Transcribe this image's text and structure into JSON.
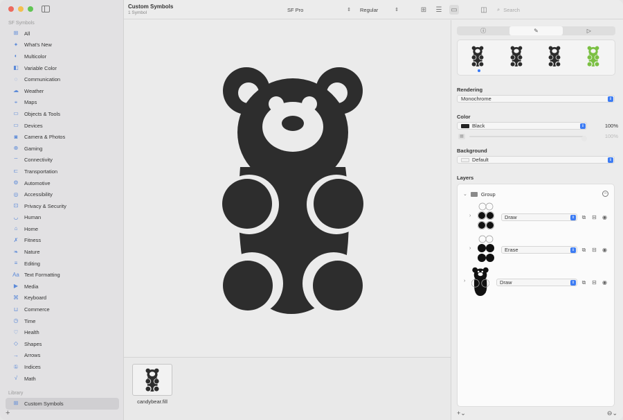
{
  "window": {
    "title": "Custom Symbols",
    "subtitle": "1 Symbol"
  },
  "toolbar": {
    "font": "SF Pro",
    "weight": "Regular",
    "search_placeholder": "Search"
  },
  "sidebar": {
    "section_title": "SF Symbols",
    "items": [
      {
        "label": "All",
        "icon": "grid-icon"
      },
      {
        "label": "What's New",
        "icon": "sparkle-icon"
      },
      {
        "label": "Multicolor",
        "icon": "palette-icon"
      },
      {
        "label": "Variable Color",
        "icon": "variable-icon"
      },
      {
        "label": "Communication",
        "icon": "bubble-icon"
      },
      {
        "label": "Weather",
        "icon": "cloud-icon"
      },
      {
        "label": "Maps",
        "icon": "map-icon"
      },
      {
        "label": "Objects & Tools",
        "icon": "folder-icon"
      },
      {
        "label": "Devices",
        "icon": "display-icon"
      },
      {
        "label": "Camera & Photos",
        "icon": "camera-icon"
      },
      {
        "label": "Gaming",
        "icon": "gamecontroller-icon"
      },
      {
        "label": "Connectivity",
        "icon": "antenna-icon"
      },
      {
        "label": "Transportation",
        "icon": "car-icon"
      },
      {
        "label": "Automotive",
        "icon": "engine-icon"
      },
      {
        "label": "Accessibility",
        "icon": "accessibility-icon"
      },
      {
        "label": "Privacy & Security",
        "icon": "lock-icon"
      },
      {
        "label": "Human",
        "icon": "person-icon"
      },
      {
        "label": "Home",
        "icon": "house-icon"
      },
      {
        "label": "Fitness",
        "icon": "figure-run-icon"
      },
      {
        "label": "Nature",
        "icon": "leaf-icon"
      },
      {
        "label": "Editing",
        "icon": "slider-icon"
      },
      {
        "label": "Text Formatting",
        "icon": "textformat-icon"
      },
      {
        "label": "Media",
        "icon": "play-rect-icon"
      },
      {
        "label": "Keyboard",
        "icon": "command-icon"
      },
      {
        "label": "Commerce",
        "icon": "cart-icon"
      },
      {
        "label": "Time",
        "icon": "clock-icon"
      },
      {
        "label": "Health",
        "icon": "heart-icon"
      },
      {
        "label": "Shapes",
        "icon": "shapes-icon"
      },
      {
        "label": "Arrows",
        "icon": "arrow-right-icon"
      },
      {
        "label": "Indices",
        "icon": "number-circle-icon"
      },
      {
        "label": "Math",
        "icon": "sqrt-icon"
      }
    ],
    "library_title": "Library",
    "library_items": [
      {
        "label": "Custom Symbols",
        "icon": "grid-icon"
      }
    ]
  },
  "gallery": {
    "symbol_name": "candybear.fill"
  },
  "inspector": {
    "tabs": [
      "info-icon",
      "paintbrush-icon",
      "play-icon"
    ],
    "rendering_label": "Rendering",
    "rendering_value": "Monochrome",
    "color_label": "Color",
    "color_value": "Black",
    "color_opacity": "100%",
    "secondary_opacity": "100%",
    "background_label": "Background",
    "background_value": "Default",
    "layers_label": "Layers",
    "group_label": "Group",
    "layers": [
      {
        "mode": "Draw"
      },
      {
        "mode": "Erase"
      },
      {
        "mode": "Draw"
      }
    ],
    "variant_colors": [
      "#2b2b2b",
      "#2b2b2b",
      "#2b2b2b",
      "#7bc043"
    ]
  },
  "colors": {
    "accent": "#3d7cf3",
    "symbol": "#2d2d2d"
  }
}
